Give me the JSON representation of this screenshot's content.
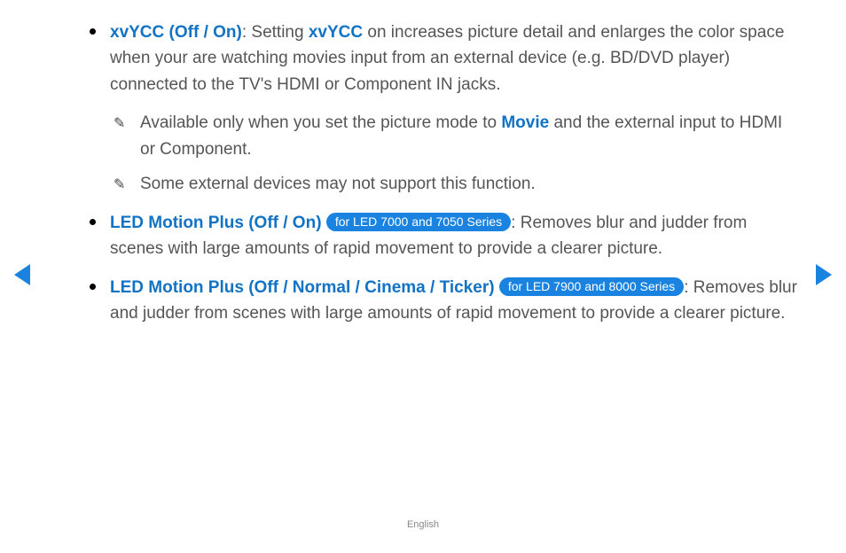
{
  "items": [
    {
      "titleKey": "i0title",
      "title": "xvYCC (Off / On)",
      "preText": ": Setting ",
      "inlineBlue": "xvYCC",
      "postText": " on increases picture detail and enlarges the color space when your are watching movies input from an external device (e.g. BD/DVD player) connected to the TV's HDMI or Component IN jacks.",
      "notes": [
        {
          "pre": "Available only when you set the picture mode to ",
          "highlight": "Movie",
          "post": " and the external input to HDMI or Component."
        },
        {
          "pre": "Some external devices may not support this function.",
          "highlight": "",
          "post": ""
        }
      ]
    },
    {
      "titleKey": "i1title",
      "title": "LED Motion Plus (Off / On)",
      "pill": "for LED 7000 and 7050 Series",
      "after": ": Removes blur and judder from scenes with large amounts of rapid movement to provide a clearer picture."
    },
    {
      "titleKey": "i2title",
      "title": "LED Motion Plus (Off / Normal / Cinema / Ticker)",
      "pill": "for LED 7900 and 8000 Series",
      "after": ": Removes blur and judder from scenes with large amounts of rapid movement to provide a clearer picture."
    }
  ],
  "lang": "English"
}
